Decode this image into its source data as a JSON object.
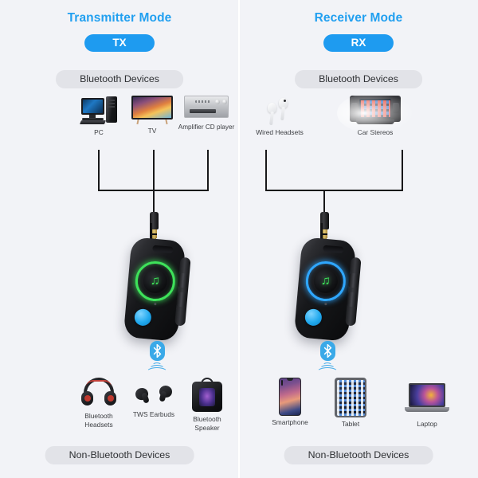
{
  "theme": {
    "background": "#f2f3f7",
    "accent_blue": "#1e9bf0",
    "title_blue": "#22a0f0",
    "pill_gray": "#e2e3e8",
    "led_green": "#3ee25a",
    "led_blue": "#2fa7ff"
  },
  "panels": [
    {
      "id": "transmitter",
      "title": "Transmitter Mode",
      "badge": "TX",
      "top_pill": "Bluetooth Devices",
      "bottom_pill": "Non-Bluetooth Devices",
      "top_devices": [
        {
          "label": "PC",
          "icon": "desktop-computer-icon"
        },
        {
          "label": "TV",
          "icon": "television-icon"
        },
        {
          "label": "Amplifier CD player",
          "icon": "amplifier-cd-player-icon"
        }
      ],
      "bottom_devices": [
        {
          "label": "Bluetooth\nHeadsets",
          "icon": "headphones-icon"
        },
        {
          "label": "TWS Earbuds",
          "icon": "earbuds-icon"
        },
        {
          "label": "Bluetooth\nSpeaker",
          "icon": "speaker-icon"
        }
      ],
      "adapter": {
        "led_color": "#3ee25a",
        "button_color": "#21a9ee"
      },
      "bluetooth_icon": "bluetooth-signal-icon"
    },
    {
      "id": "receiver",
      "title": "Receiver Mode",
      "badge": "RX",
      "top_pill": "Bluetooth Devices",
      "bottom_pill": "Non-Bluetooth Devices",
      "top_devices": [
        {
          "label": "Wired Headsets",
          "icon": "wired-earbuds-icon"
        },
        {
          "label": "Car Stereos",
          "icon": "car-stereo-icon"
        }
      ],
      "bottom_devices": [
        {
          "label": "Smartphone",
          "icon": "smartphone-icon"
        },
        {
          "label": "Tablet",
          "icon": "tablet-icon"
        },
        {
          "label": "Laptop",
          "icon": "laptop-icon"
        }
      ],
      "adapter": {
        "led_color": "#2fa7ff",
        "button_color": "#21a9ee"
      },
      "bluetooth_icon": "bluetooth-signal-icon"
    }
  ]
}
